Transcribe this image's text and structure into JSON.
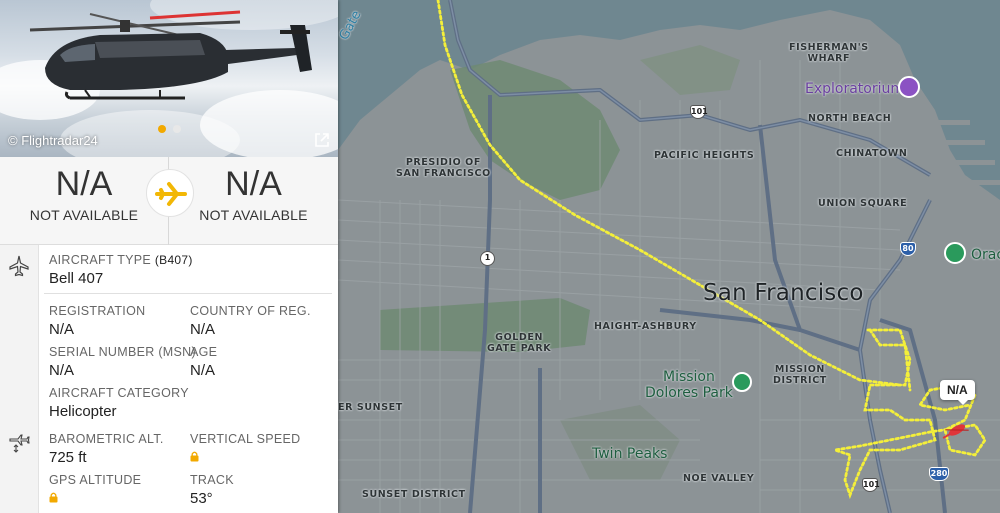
{
  "photo": {
    "credit": "© Flightradar24",
    "dots": [
      true,
      false
    ]
  },
  "route": {
    "origin": {
      "code": "N/A",
      "name": "NOT AVAILABLE"
    },
    "destination": {
      "code": "N/A",
      "name": "NOT AVAILABLE"
    }
  },
  "aircraft": {
    "type_label": "AIRCRAFT TYPE",
    "type_code": "(B407)",
    "type_value": "Bell 407",
    "registration_label": "REGISTRATION",
    "registration_value": "N/A",
    "country_label": "COUNTRY OF REG.",
    "country_value": "N/A",
    "serial_label": "SERIAL NUMBER (MSN)",
    "serial_value": "N/A",
    "age_label": "AGE",
    "age_value": "N/A",
    "category_label": "AIRCRAFT CATEGORY",
    "category_value": "Helicopter"
  },
  "flight": {
    "baro_alt_label": "BAROMETRIC ALT.",
    "baro_alt_value": "725 ft",
    "vspeed_label": "VERTICAL SPEED",
    "gps_alt_label": "GPS ALTITUDE",
    "track_label": "TRACK",
    "track_value": "53°"
  },
  "map": {
    "marker_label": "N/A",
    "labels": {
      "golden_gate": "Gate",
      "fishermans_wharf": "FISHERMAN'S\nWHARF",
      "exploratorium": "Exploratorium",
      "north_beach": "NORTH BEACH",
      "presidio": "PRESIDIO OF\nSAN FRANCISCO",
      "pacific_heights": "PACIFIC HEIGHTS",
      "chinatown": "CHINATOWN",
      "union_square": "UNION SQUARE",
      "oracle": "Orac",
      "city": "San Francisco",
      "haight": "HAIGHT-ASHBURY",
      "golden_gate_park": "GOLDEN\nGATE PARK",
      "mission_dolores": "Mission\nDolores Park",
      "mission_district": "MISSION\nDISTRICT",
      "sunset": "ER SUNSET",
      "twin_peaks": "Twin Peaks",
      "noe_valley": "NOE VALLEY",
      "sunset_district": "SUNSET DISTRICT"
    },
    "shields": {
      "us101_north": "101",
      "ca1": "1",
      "i80": "80",
      "i280": "280",
      "us101_south": "101"
    }
  }
}
